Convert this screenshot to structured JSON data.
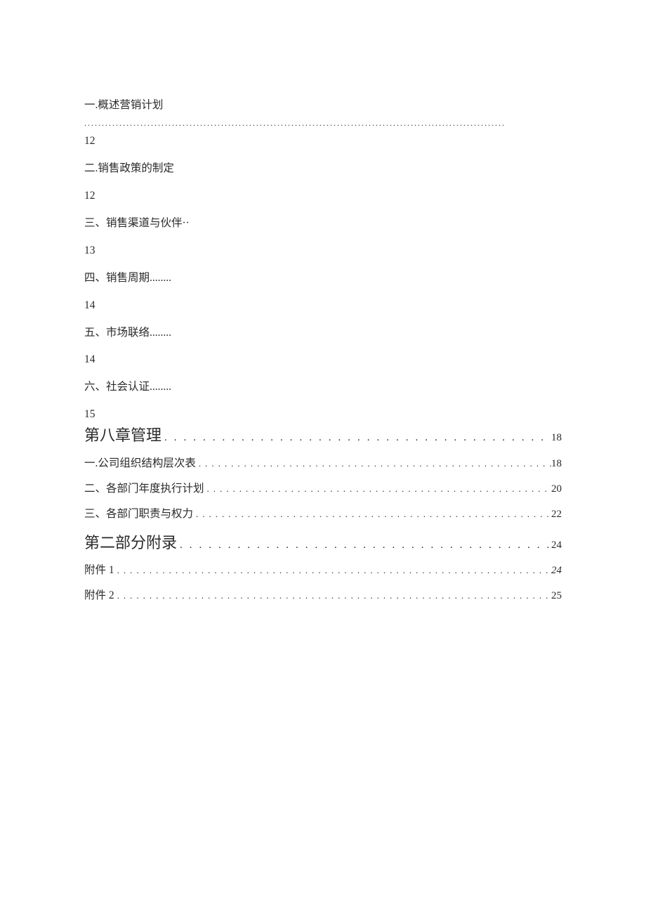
{
  "simple_entries": [
    {
      "title": "一.概述营销计划",
      "has_dots": true,
      "page": "12"
    },
    {
      "title": "二.销售政策的制定",
      "has_dots": false,
      "page": "12"
    },
    {
      "title": "三、销售渠道与伙伴··",
      "has_dots": false,
      "page": "13"
    },
    {
      "title": "四、销售周期........",
      "has_dots": false,
      "page": "14"
    },
    {
      "title": "五、市场联络........",
      "has_dots": false,
      "page": "14"
    },
    {
      "title": "六、社会认证........",
      "has_dots": false,
      "page": "15"
    }
  ],
  "toc_rows": [
    {
      "title": "第八章管理",
      "page": "18",
      "heading": true,
      "italic": false
    },
    {
      "title": "一.公司组织结构层次表",
      "page": "18",
      "heading": false,
      "italic": false
    },
    {
      "title": "二、各部门年度执行计划",
      "page": "20",
      "heading": false,
      "italic": false
    },
    {
      "title": "三、各部门职责与权力",
      "page": "22",
      "heading": false,
      "italic": false
    },
    {
      "title": "第二部分附录",
      "page": "24",
      "heading": true,
      "italic": false
    },
    {
      "title": "附件 1",
      "page": "24",
      "heading": false,
      "italic": true
    },
    {
      "title": "附件 2",
      "page": "25",
      "heading": false,
      "italic": false
    }
  ],
  "leaders": {
    "wide": "........................................................................................................................",
    "normal": "........................................................................................................................................................................",
    "heading": "........................................................................"
  }
}
